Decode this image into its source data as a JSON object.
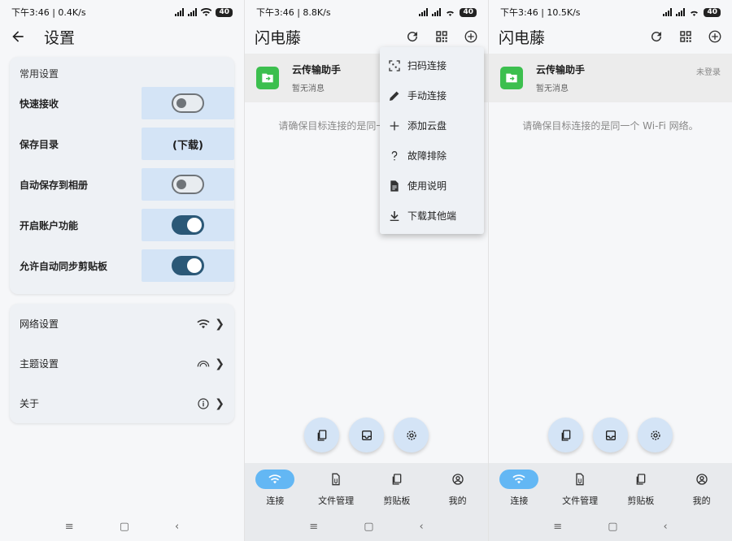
{
  "settings_panel": {
    "status": {
      "text": "下午3:46 | 0.4K/s",
      "battery": "40"
    },
    "title": "设置",
    "section_title": "常用设置",
    "rows": [
      {
        "label": "快速接收",
        "control": "toggle",
        "on": false
      },
      {
        "label": "保存目录",
        "control": "text",
        "value": "(下载)"
      },
      {
        "label": "自动保存到相册",
        "control": "toggle",
        "on": false
      },
      {
        "label": "开启账户功能",
        "control": "toggle",
        "on": true
      },
      {
        "label": "允许自动同步剪贴板",
        "control": "toggle",
        "on": true
      }
    ],
    "links": [
      {
        "label": "网络设置",
        "icon": "wifi-icon"
      },
      {
        "label": "主题设置",
        "icon": "rainbow-icon"
      },
      {
        "label": "关于",
        "icon": "info-icon"
      }
    ]
  },
  "menu_panel": {
    "status": {
      "text": "下午3:46 | 8.8K/s",
      "battery": "40"
    },
    "title": "闪电藤",
    "device": {
      "name": "云传输助手",
      "subtitle": "暂无消息"
    },
    "hint": "请确保目标连接的是同一个 Wi-Fi 网络。",
    "menu": [
      {
        "label": "扫码连接",
        "icon": "scan-icon"
      },
      {
        "label": "手动连接",
        "icon": "pencil-icon"
      },
      {
        "label": "添加云盘",
        "icon": "plus-icon"
      },
      {
        "label": "故障排除",
        "icon": "question-icon"
      },
      {
        "label": "使用说明",
        "icon": "document-icon"
      },
      {
        "label": "下载其他端",
        "icon": "download-icon"
      }
    ]
  },
  "home_panel": {
    "status": {
      "text": "下午3:46 | 10.5K/s",
      "battery": "40"
    },
    "title": "闪电藤",
    "device": {
      "name": "云传输助手",
      "subtitle": "暂无消息",
      "status": "未登录"
    },
    "hint": "请确保目标连接的是同一个 Wi-Fi 网络。"
  },
  "nav": [
    {
      "label": "连接",
      "icon": "wifi-icon",
      "active": true
    },
    {
      "label": "文件管理",
      "icon": "file-icon",
      "active": false
    },
    {
      "label": "剪贴板",
      "icon": "clipboard-icon",
      "active": false
    },
    {
      "label": "我的",
      "icon": "account-icon",
      "active": false
    }
  ],
  "sysnav": {
    "menu": "≡",
    "home": "▢",
    "back": "‹"
  },
  "colors": {
    "accent": "#63b7f4",
    "toggle_on": "#2b5877",
    "control_bg": "#d4e4f6",
    "device_icon": "#3cbf4e"
  }
}
